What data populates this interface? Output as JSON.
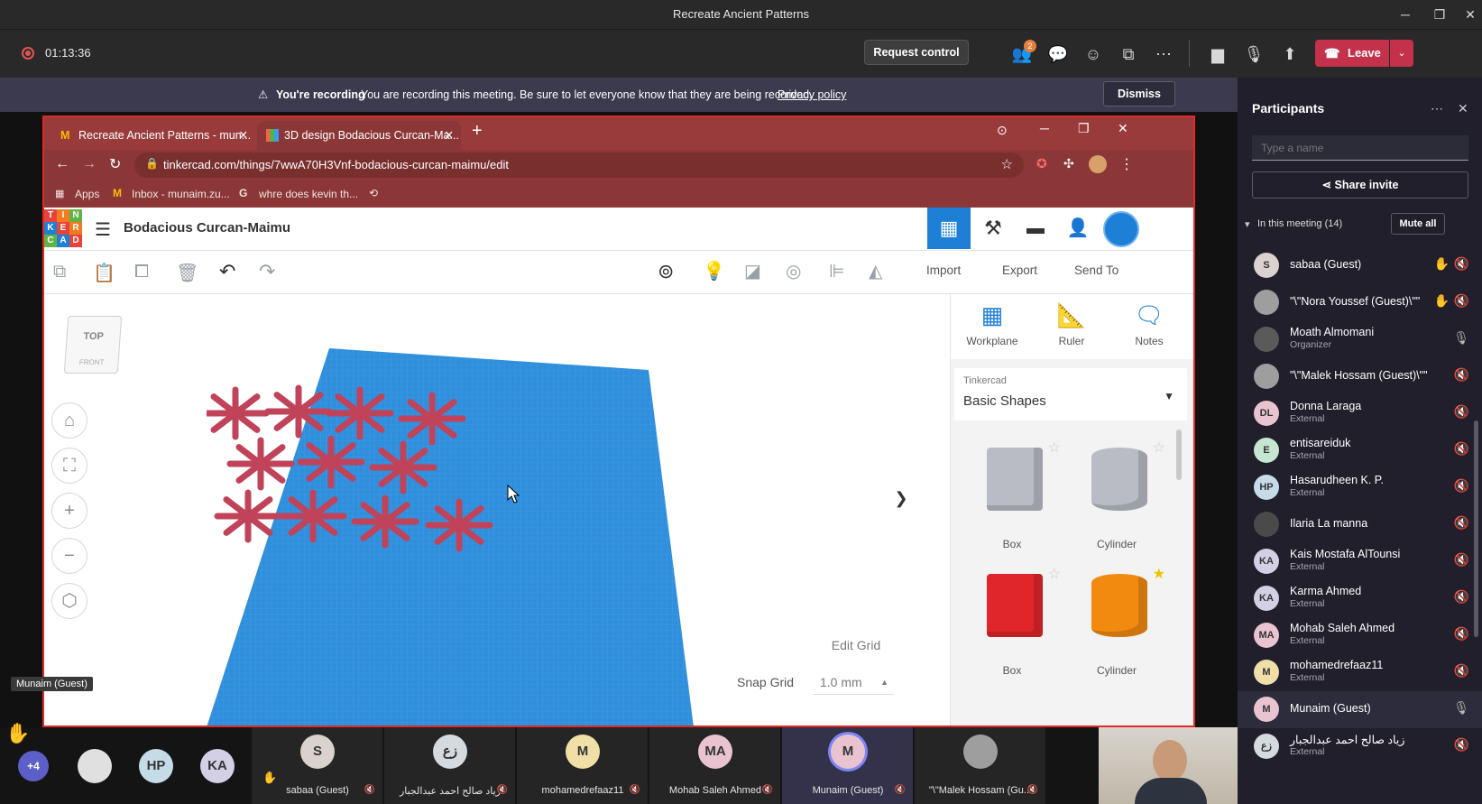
{
  "window": {
    "title": "Recreate Ancient Patterns",
    "min": "─",
    "max": "❐",
    "close": "✕"
  },
  "meeting": {
    "timer": "01:13:36",
    "request_control": "Request control",
    "people_badge": "2",
    "leave": "Leave"
  },
  "banner": {
    "heading": "You're recording",
    "message": "You are recording this meeting. Be sure to let everyone know that they are being recorded.",
    "link": "Privacy policy",
    "dismiss": "Dismiss"
  },
  "browser": {
    "tabs": [
      {
        "label": "Recreate Ancient Patterns - mun..."
      },
      {
        "label": "3D design Bodacious Curcan-Ma..."
      }
    ],
    "url": "tinkercad.com/things/7wwA70H3Vnf-bodacious-curcan-maimu/edit",
    "bookmarks": [
      "Apps",
      "Inbox - munaim.zu...",
      "whre does kevin th..."
    ]
  },
  "tinkercad": {
    "logo": [
      "T",
      "I",
      "N",
      "K",
      "E",
      "R",
      "C",
      "A",
      "D"
    ],
    "title": "Bodacious Curcan-Maimu",
    "actions": [
      "Import",
      "Export",
      "Send To"
    ],
    "viewcube": {
      "top": "TOP",
      "front": "FRONT"
    },
    "tools": [
      {
        "label": "Workplane"
      },
      {
        "label": "Ruler"
      },
      {
        "label": "Notes"
      }
    ],
    "library_source": "Tinkercad",
    "library_name": "Basic Shapes",
    "shapes": [
      {
        "label": "Box",
        "color": "#b9bcc4"
      },
      {
        "label": "Cylinder",
        "color": "#b9bcc4"
      },
      {
        "label": "Box",
        "color": "#e0262b"
      },
      {
        "label": "Cylinder",
        "color": "#f28a10"
      }
    ],
    "edit_grid": "Edit Grid",
    "snap_grid_label": "Snap Grid",
    "snap_grid_value": "1.0 mm",
    "workplane_color": "#2f8fdc",
    "pattern_color": "#c0435a"
  },
  "participants": {
    "title": "Participants",
    "search_placeholder": "Type a name",
    "share_invite": "Share invite",
    "section": "In this meeting (14)",
    "mute_all": "Mute all",
    "people": [
      {
        "initials": "S",
        "name": "sabaa (Guest)",
        "sub": "",
        "color": "#d9d2ce",
        "hand": true,
        "mic": "muted"
      },
      {
        "initials": "",
        "name": "\"\\\"Nora Youssef (Guest)\\\"\"",
        "sub": "",
        "color": "#9e9e9e",
        "hand": true,
        "mic": "muted"
      },
      {
        "initials": "",
        "name": "Moath Almomani",
        "sub": "Organizer",
        "color": "#5a5a5a",
        "hand": false,
        "mic": "on"
      },
      {
        "initials": "",
        "name": "\"\\\"Malek Hossam (Guest)\\\"\"",
        "sub": "",
        "color": "#9e9e9e",
        "hand": false,
        "mic": "muted"
      },
      {
        "initials": "DL",
        "name": "Donna Laraga",
        "sub": "External",
        "color": "#e9c4d0",
        "hand": false,
        "mic": "muted"
      },
      {
        "initials": "E",
        "name": "entisareiduk",
        "sub": "External",
        "color": "#c7e6cf",
        "hand": false,
        "mic": "muted"
      },
      {
        "initials": "HP",
        "name": "Hasarudheen K. P.",
        "sub": "External",
        "color": "#c6dbe8",
        "hand": false,
        "mic": "muted"
      },
      {
        "initials": "",
        "name": "Ilaria La manna",
        "sub": "",
        "color": "#4a4a4a",
        "hand": false,
        "mic": "muted"
      },
      {
        "initials": "KA",
        "name": "Kais Mostafa AlTounsi",
        "sub": "External",
        "color": "#d3d0e6",
        "hand": false,
        "mic": "muted"
      },
      {
        "initials": "KA",
        "name": "Karma Ahmed",
        "sub": "External",
        "color": "#d3d0e6",
        "hand": false,
        "mic": "muted"
      },
      {
        "initials": "MA",
        "name": "Mohab Saleh Ahmed",
        "sub": "External",
        "color": "#e9c4d0",
        "hand": false,
        "mic": "muted"
      },
      {
        "initials": "M",
        "name": "mohamedrefaaz11",
        "sub": "External",
        "color": "#f1dfa8",
        "hand": false,
        "mic": "muted"
      },
      {
        "initials": "M",
        "name": "Munaim (Guest)",
        "sub": "",
        "color": "#e9c4d0",
        "hand": false,
        "mic": "on"
      },
      {
        "initials": "زع",
        "name": "زياد صالح احمد عبدالجبار",
        "sub": "External",
        "color": "#d5dadf",
        "hand": false,
        "mic": "muted"
      }
    ]
  },
  "strip": {
    "presenter_label": "Munaim (Guest)",
    "more_count": "+4",
    "small": [
      {
        "initials": "",
        "color": "#e0e0e0"
      },
      {
        "initials": "HP",
        "color": "#c6dbe8"
      },
      {
        "initials": "KA",
        "color": "#d3d0e6"
      }
    ],
    "tiles": [
      {
        "initials": "S",
        "name": "sabaa (Guest)",
        "color": "#d9d2ce",
        "hand": true
      },
      {
        "initials": "زع",
        "name": "زياد صالح احمد عبدالجبار",
        "color": "#d5dadf",
        "hand": false
      },
      {
        "initials": "M",
        "name": "mohamedrefaaz11",
        "color": "#f1dfa8",
        "hand": false
      },
      {
        "initials": "MA",
        "name": "Mohab Saleh Ahmed",
        "color": "#e9c4d0",
        "hand": false
      },
      {
        "initials": "M",
        "name": "Munaim (Guest)",
        "color": "#e9c4d0",
        "hand": false
      },
      {
        "initials": "",
        "name": "\"\\\"Malek Hossam (Gu...",
        "color": "#9e9e9e",
        "hand": false
      }
    ]
  }
}
